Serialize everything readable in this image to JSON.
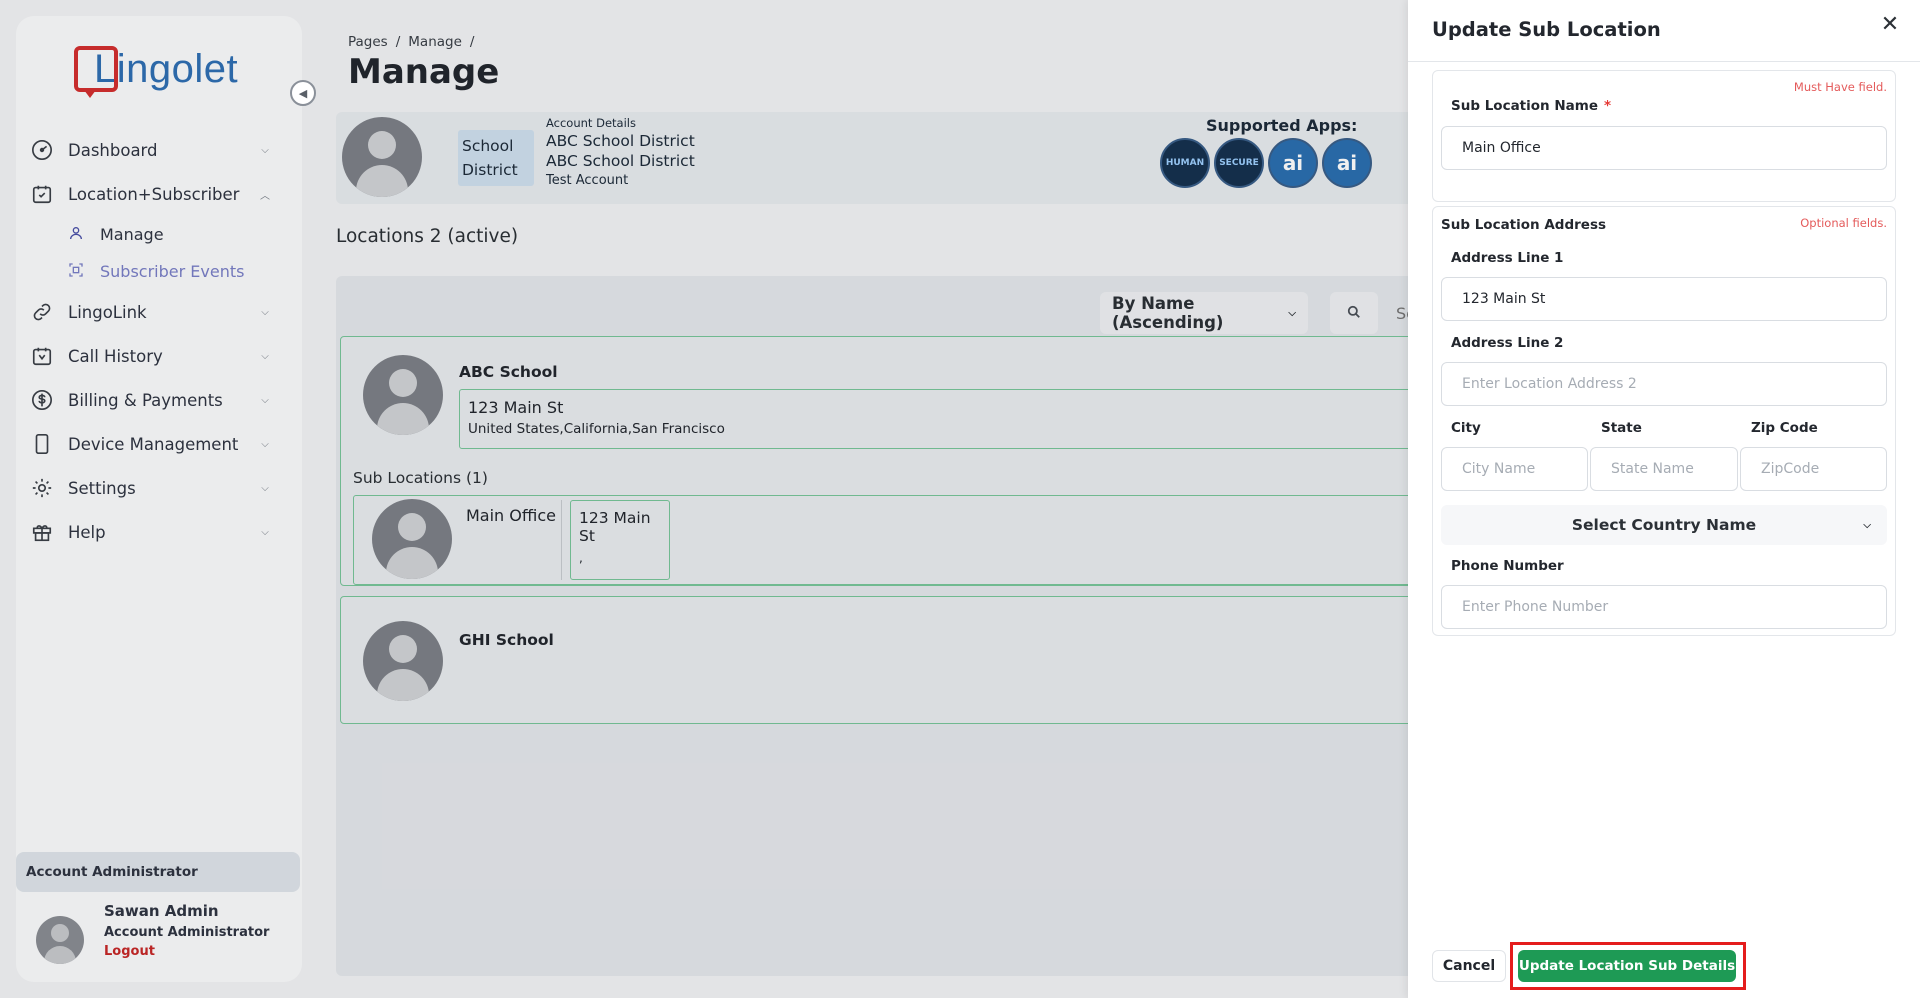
{
  "app": {
    "logo_text": "Lingolet"
  },
  "sidebar": {
    "items": [
      {
        "label": "Dashboard",
        "icon": "gauge-icon"
      },
      {
        "label": "Location+Subscriber",
        "icon": "calendar-check-icon"
      },
      {
        "label": "LingoLink",
        "icon": "link-icon"
      },
      {
        "label": "Call History",
        "icon": "calendar-icon"
      },
      {
        "label": "Billing & Payments",
        "icon": "dollar-icon"
      },
      {
        "label": "Device Management",
        "icon": "phone-device-icon"
      },
      {
        "label": "Settings",
        "icon": "gear-icon"
      },
      {
        "label": "Help",
        "icon": "gift-icon"
      }
    ],
    "subitems": [
      {
        "label": "Manage",
        "icon": "user-icon"
      },
      {
        "label": "Subscriber Events",
        "icon": "scan-icon"
      }
    ],
    "role_badge": "Account Administrator",
    "user": {
      "name": "Sawan Admin",
      "role": "Account Administrator",
      "logout": "Logout"
    }
  },
  "header": {
    "breadcrumb": [
      "Pages",
      "Manage"
    ],
    "title": "Manage"
  },
  "account": {
    "type_line1": "School",
    "type_line2": "District",
    "details_label": "Account Details",
    "name1": "ABC School District",
    "name2": "ABC School District",
    "kind": "Test Account",
    "apps_label": "Supported Apps:",
    "apps": [
      "HUMAN",
      "SECURE",
      "ai",
      "ai"
    ]
  },
  "locations": {
    "heading": "Locations 2 (active)",
    "sort": "By Name (Ascending)",
    "search_placeholder": "Se",
    "items": [
      {
        "name": "ABC School",
        "addr1": "123 Main St",
        "addr2": "United States,California,San Francisco",
        "sub_heading": "Sub Locations (1)",
        "sub": {
          "name": "Main Office",
          "addr1": "123 Main St",
          "addr2": ","
        }
      },
      {
        "name": "GHI School"
      }
    ]
  },
  "drawer": {
    "title": "Update Sub Location",
    "must_have": "Must Have field.",
    "optional": "Optional fields.",
    "name_label": "Sub Location Name",
    "required_mark": "*",
    "name_value": "Main Office",
    "address_title": "Sub Location Address",
    "addr1_label": "Address Line 1",
    "addr1_value": "123 Main St",
    "addr2_label": "Address Line 2",
    "addr2_placeholder": "Enter Location Address 2",
    "city_label": "City",
    "city_placeholder": "City Name",
    "state_label": "State",
    "state_placeholder": "State Name",
    "zip_label": "Zip Code",
    "zip_placeholder": "ZipCode",
    "country": "Select Country Name",
    "phone_label": "Phone Number",
    "phone_placeholder": "Enter Phone Number",
    "cancel": "Cancel",
    "submit": "Update Location Sub Details"
  },
  "colors": {
    "primary_button": "#1e9a55",
    "highlight": "#e41c1c",
    "card_border": "#78c59a",
    "logo_red": "#d32f2f",
    "logo_blue": "#2f6fb3"
  }
}
